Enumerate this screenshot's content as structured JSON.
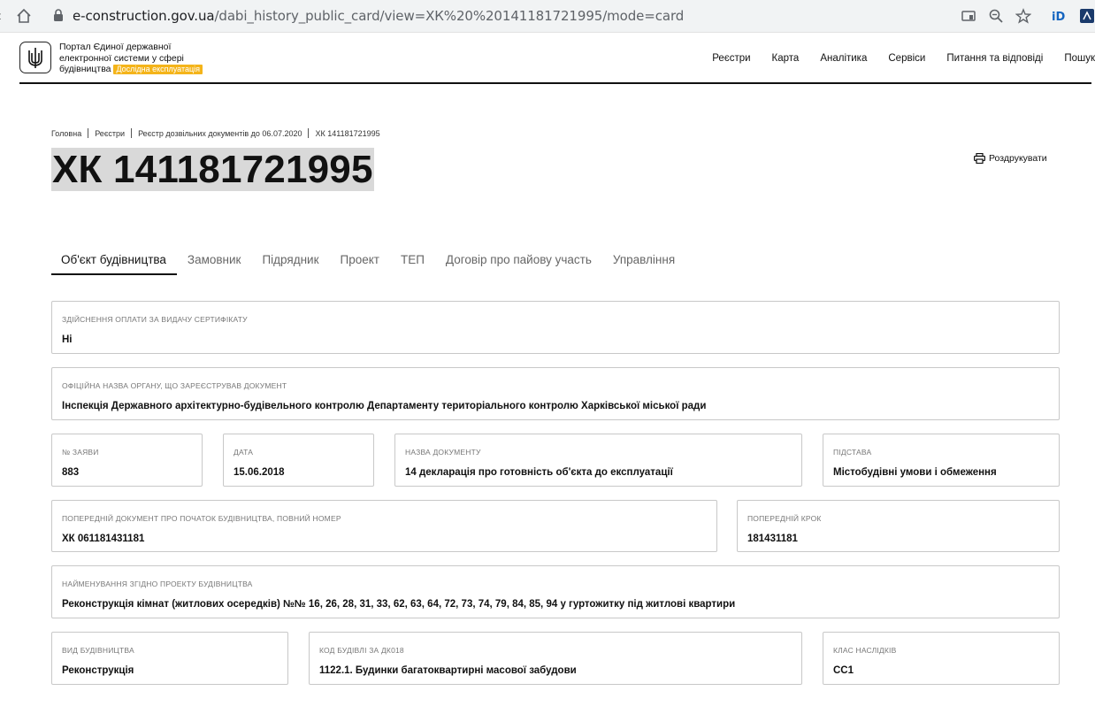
{
  "browser": {
    "url_host": "e-construction.gov.ua",
    "url_path": "/dabi_history_public_card/view=ХК%20%20141181721995/mode=card"
  },
  "header": {
    "logo_line1": "Портал Єдиної державної",
    "logo_line2": "електронної системи у сфері",
    "logo_line3": "будівництва",
    "logo_badge": "Дослідна експлуатація",
    "nav": [
      "Реєстри",
      "Карта",
      "Аналітика",
      "Сервіси",
      "Питання та відповіді",
      "Пошук"
    ]
  },
  "breadcrumb": [
    "Головна",
    "Реєстри",
    "Реєстр дозвільних документів до 06.07.2020",
    "ХК 141181721995"
  ],
  "title": "ХК 141181721995",
  "print_label": "Роздрукувати",
  "tabs": [
    "Об'єкт будівництва",
    "Замовник",
    "Підрядник",
    "Проект",
    "ТЕП",
    "Договір про пайову участь",
    "Управління"
  ],
  "fields": {
    "payment": {
      "label": "Здійснення оплати за видачу сертифікату",
      "value": "Ні"
    },
    "authority": {
      "label": "Офіційна назва органу, що зареєстрував документ",
      "value": "Інспекція Державного архітектурно-будівельного контролю Департаменту територіального контролю Харківської міської ради"
    },
    "application_no": {
      "label": "№ заяви",
      "value": "883"
    },
    "date": {
      "label": "Дата",
      "value": "15.06.2018"
    },
    "doc_name": {
      "label": "Назва документу",
      "value": "14 декларація про готовність об'єкта до експлуатації"
    },
    "basis": {
      "label": "Підстава",
      "value": "Містобудівні умови і обмеження"
    },
    "prev_doc": {
      "label": "Попередній документ про початок будівництва, повний номер",
      "value": "ХК 061181431181"
    },
    "prev_step": {
      "label": "Попередній крок",
      "value": "181431181"
    },
    "project_name": {
      "label": "Найменування згідно проекту будівництва",
      "value": "Реконструкція кімнат (житлових осередків) №№ 16, 26, 28, 31, 33, 62, 63, 64, 72, 73, 74, 79, 84, 85, 94 у гуртожитку під житлові квартири"
    },
    "construction_type": {
      "label": "Вид будівництва",
      "value": "Реконструкція"
    },
    "building_code": {
      "label": "Код будівлі за ДК018",
      "value": "1122.1. Будинки багатоквартирні масової забудови"
    },
    "consequence_class": {
      "label": "Клас наслідків",
      "value": "СС1"
    }
  }
}
